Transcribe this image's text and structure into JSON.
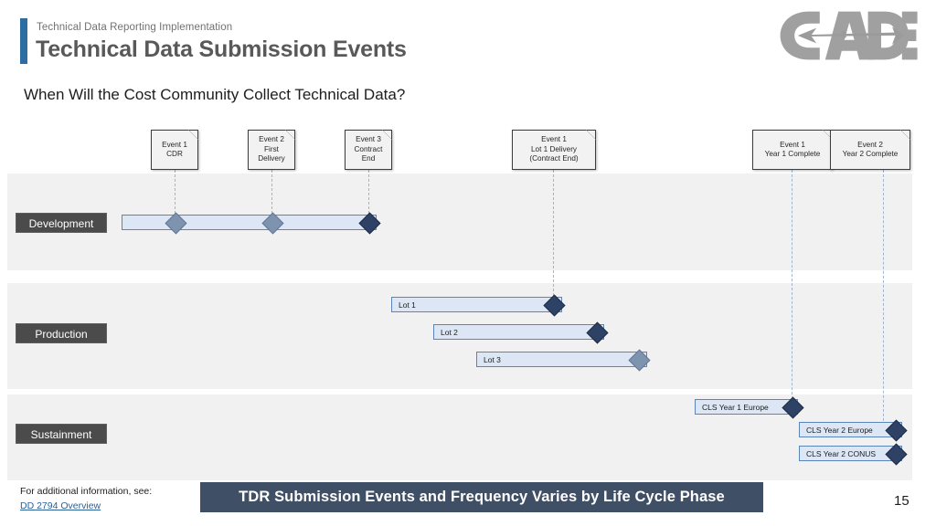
{
  "header": {
    "eyebrow": "Technical Data Reporting Implementation",
    "title": "Technical Data Submission Events",
    "subtitle": "When Will the Cost Community Collect Technical Data?",
    "logo_name": "cade-logo",
    "accent_color": "#2e6ca4"
  },
  "milestones": [
    {
      "id": "m1",
      "line1": "Event 1",
      "line2": "CDR",
      "line3": ""
    },
    {
      "id": "m2",
      "line1": "Event 2",
      "line2": "First",
      "line3": "Delivery"
    },
    {
      "id": "m3",
      "line1": "Event 3",
      "line2": "Contract",
      "line3": "End"
    },
    {
      "id": "m4",
      "line1": "Event 1",
      "line2": "Lot 1 Delivery",
      "line3": "(Contract End)"
    },
    {
      "id": "m5",
      "line1": "Event 1",
      "line2": "Year 1 Complete",
      "line3": ""
    },
    {
      "id": "m6",
      "line1": "Event 2",
      "line2": "Year 2 Complete",
      "line3": ""
    }
  ],
  "phases": [
    {
      "id": "development",
      "label": "Development"
    },
    {
      "id": "production",
      "label": "Production"
    },
    {
      "id": "sustainment",
      "label": "Sustainment"
    }
  ],
  "bars": {
    "development": [
      {
        "label": ""
      }
    ],
    "production": [
      {
        "label": "Lot 1"
      },
      {
        "label": "Lot 2"
      },
      {
        "label": "Lot 3"
      }
    ],
    "sustainment": [
      {
        "label": "CLS Year 1 Europe"
      },
      {
        "label": "CLS Year 2 Europe"
      },
      {
        "label": "CLS Year 2 CONUS"
      }
    ]
  },
  "footer": {
    "note": "For additional information, see:",
    "link": "DD 2794 Overview",
    "banner": "TDR Submission Events and Frequency Varies by Life Cycle Phase",
    "page": "15"
  },
  "colors": {
    "band": "#f1f1f1",
    "phase_label_bg": "#4b4b4b",
    "bar_fill": "#dce6f4",
    "bar_border": "#5b84b8",
    "diamond_dark": "#2e4265",
    "diamond_light": "#7e93ae",
    "banner": "#3f4f66",
    "link": "#2a6099",
    "dash": "#9fb6cf"
  }
}
